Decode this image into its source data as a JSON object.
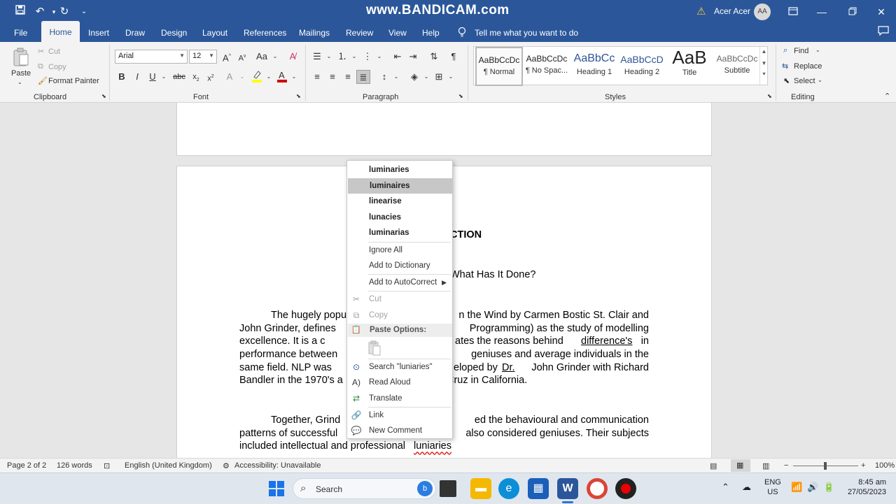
{
  "watermark": "www.BANDICAM.com",
  "titlebar": {
    "account_name": "Acer Acer",
    "avatar_initials": "AA"
  },
  "menu": {
    "tabs": [
      "File",
      "Home",
      "Insert",
      "Draw",
      "Design",
      "Layout",
      "References",
      "Mailings",
      "Review",
      "View",
      "Help"
    ],
    "tell_me": "Tell me what you want to do"
  },
  "ribbon": {
    "clipboard": {
      "paste": "Paste",
      "cut": "Cut",
      "copy": "Copy",
      "format_painter": "Format Painter",
      "label": "Clipboard"
    },
    "font": {
      "name": "Arial",
      "size": "12",
      "label": "Font"
    },
    "paragraph": {
      "label": "Paragraph"
    },
    "styles": {
      "label": "Styles",
      "items": [
        {
          "sample": "AaBbCcDc",
          "name": "¶ Normal"
        },
        {
          "sample": "AaBbCcDc",
          "name": "¶ No Spac..."
        },
        {
          "sample": "AaBbCc",
          "name": "Heading 1"
        },
        {
          "sample": "AaBbCcD",
          "name": "Heading 2"
        },
        {
          "sample": "AaB",
          "name": "Title"
        },
        {
          "sample": "AaBbCcDc",
          "name": "Subtitle"
        }
      ]
    },
    "editing": {
      "find": "Find",
      "replace": "Replace",
      "select": "Select",
      "label": "Editing"
    }
  },
  "document": {
    "heading_fragment": "CTION",
    "subtitle_fragment": "What Has It Done?",
    "p1": {
      "l1a": "The hugely popu",
      "l1b": "n the Wind by Carmen Bostic St. Clair and",
      "l2a": "John Grinder, defines",
      "l2b": "Programming) as the study of modelling",
      "l3a": "excellence.  It is a c",
      "l3b": "ates the reasons behind",
      "l3c": "difference's",
      "l3d": "in",
      "l4a": "performance between",
      "l4b": "geniuses and average individuals in the",
      "l5a": "same field.  NLP was",
      "l5b": "eloped by",
      "l5c": "Dr.",
      "l5d": "John Grinder with Richard",
      "l6a": "Bandler in the 1970's a",
      "l6b": "Cruz in California."
    },
    "p2": {
      "l1a": "Together, Grind",
      "l1b": "ed the behavioural and communication",
      "l2a": "patterns of successful",
      "l2b": "also considered geniuses.  Their subjects",
      "l3a": "included intellectual and professional",
      "l3b": "luniaries"
    }
  },
  "context_menu": {
    "suggestions": [
      "luminaries",
      "luminaires",
      "linearise",
      "lunacies",
      "luminarias"
    ],
    "ignore_all": "Ignore All",
    "add_to_dictionary": "Add to Dictionary",
    "add_to_autocorrect": "Add to AutoCorrect",
    "cut": "Cut",
    "copy": "Copy",
    "paste_options": "Paste Options:",
    "search": "Search \"luniaries\"",
    "read_aloud": "Read Aloud",
    "translate": "Translate",
    "link": "Link",
    "new_comment": "New Comment"
  },
  "statusbar": {
    "page": "Page 2 of 2",
    "words": "126 words",
    "language": "English (United Kingdom)",
    "accessibility": "Accessibility: Unavailable",
    "zoom": "100%"
  },
  "taskbar": {
    "search_placeholder": "Search",
    "lang_line1": "ENG",
    "lang_line2": "US",
    "time": "8:45 am",
    "date": "27/05/2023"
  },
  "colors": {
    "word_blue": "#2b579a",
    "selection_grey": "#c7c7c7",
    "spell_red": "#d22"
  }
}
